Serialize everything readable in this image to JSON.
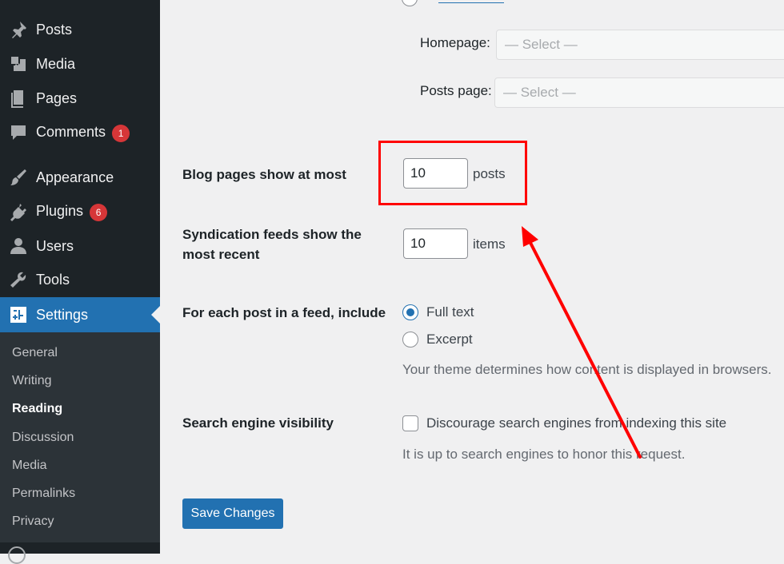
{
  "sidebar": {
    "menu": [
      {
        "label": "Posts",
        "icon": "pin-icon"
      },
      {
        "label": "Media",
        "icon": "media-icon"
      },
      {
        "label": "Pages",
        "icon": "pages-icon"
      },
      {
        "label": "Comments",
        "icon": "comment-icon",
        "badge": "1"
      },
      {
        "label": "Appearance",
        "icon": "brush-icon"
      },
      {
        "label": "Plugins",
        "icon": "plug-icon",
        "badge": "6"
      },
      {
        "label": "Users",
        "icon": "user-icon"
      },
      {
        "label": "Tools",
        "icon": "wrench-icon"
      },
      {
        "label": "Settings",
        "icon": "settings-icon",
        "active": true
      }
    ],
    "submenu": [
      {
        "label": "General"
      },
      {
        "label": "Writing"
      },
      {
        "label": "Reading",
        "current": true
      },
      {
        "label": "Discussion"
      },
      {
        "label": "Media"
      },
      {
        "label": "Permalinks"
      },
      {
        "label": "Privacy"
      }
    ]
  },
  "main": {
    "homepage_label": "Homepage:",
    "homepage_select": "— Select —",
    "posts_page_label": "Posts page:",
    "posts_page_select": "— Select —",
    "blog_pages_label": "Blog pages show at most",
    "blog_pages_value": "10",
    "blog_pages_unit": "posts",
    "syndication_label_line1": "Syndication feeds show the",
    "syndication_label_line2": "most recent",
    "syndication_value": "10",
    "syndication_unit": "items",
    "feed_label": "For each post in a feed, include",
    "feed_options": [
      {
        "label": "Full text",
        "checked": true
      },
      {
        "label": "Excerpt",
        "checked": false
      }
    ],
    "feed_description": "Your theme determines how content is displayed in browsers.",
    "search_label": "Search engine visibility",
    "search_checkbox_label": "Discourage search engines from indexing this site",
    "search_checked": false,
    "search_description": "It is up to search engines to honor this request.",
    "save_button": "Save Changes"
  },
  "colors": {
    "sidebar_bg": "#1d2327",
    "submenu_bg": "#2c3338",
    "accent": "#2271b1",
    "badge": "#d63638",
    "annotation": "#ff0000"
  }
}
